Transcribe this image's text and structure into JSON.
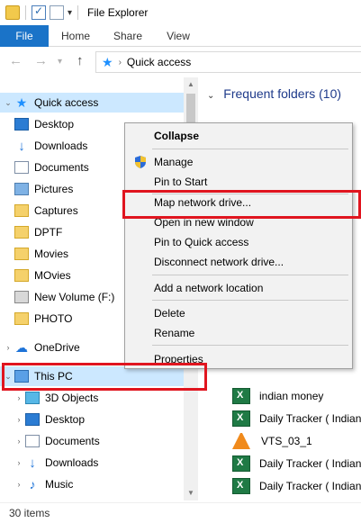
{
  "window": {
    "title": "File Explorer"
  },
  "ribbon": {
    "tabs": [
      "File",
      "Home",
      "Share",
      "View"
    ]
  },
  "address": {
    "location": "Quick access",
    "separator": "›"
  },
  "nav": {
    "quick_access": "Quick access",
    "items": [
      "Desktop",
      "Downloads",
      "Documents",
      "Pictures",
      "Captures",
      "DPTF",
      "Movies",
      "MOvies",
      "New Volume (F:)",
      "PHOTO"
    ],
    "onedrive": "OneDrive",
    "this_pc": "This PC",
    "pc_items": [
      "3D Objects",
      "Desktop",
      "Documents",
      "Downloads",
      "Music"
    ]
  },
  "content": {
    "section": "Frequent folders (10)",
    "files": [
      "indian money",
      "Daily Tracker ( Indian",
      "VTS_03_1",
      "Daily Tracker ( Indian",
      "Daily Tracker ( Indian"
    ]
  },
  "context_menu": {
    "items": [
      "Collapse",
      "Manage",
      "Pin to Start",
      "Map network drive...",
      "Open in new window",
      "Pin to Quick access",
      "Disconnect network drive...",
      "Add a network location",
      "Delete",
      "Rename",
      "Properties"
    ]
  },
  "status": {
    "count": "30 items"
  },
  "colors": {
    "accent": "#1a73c8",
    "selection": "#cce8ff",
    "highlight": "#e0151f"
  }
}
